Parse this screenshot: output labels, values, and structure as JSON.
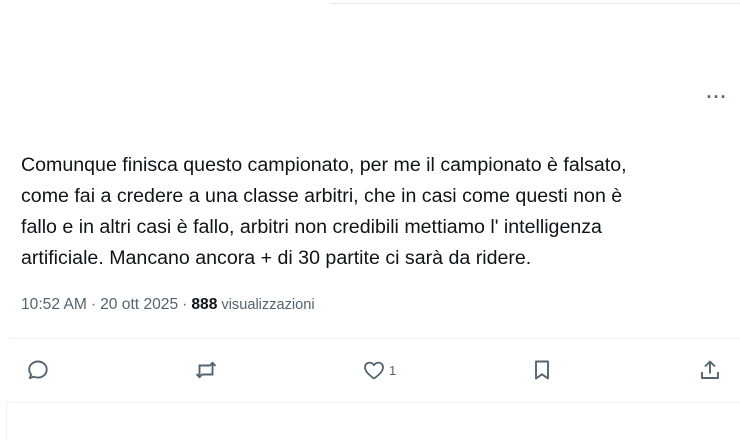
{
  "tweet": {
    "text": "Comunque finisca questo campionato, per me il campionato è falsato,\ncome fai a credere a una classe arbitri, che in casi come questi non è\nfallo e in altri casi è fallo, arbitri non credibili mettiamo l' intelligenza\nartificiale. Mancano ancora + di 30 partite ci sarà da ridere.",
    "time": "10:52 AM",
    "date": "20 ott 2025",
    "separator": "·",
    "views_count": "888",
    "views_label": "visualizzazioni"
  },
  "more_menu": {
    "label": "···",
    "icon": "more-horizontal-icon"
  },
  "actions": {
    "reply": {
      "icon": "reply-icon"
    },
    "repost": {
      "icon": "repost-icon"
    },
    "like": {
      "icon": "heart-icon",
      "count": "1"
    },
    "bookmark": {
      "icon": "bookmark-icon"
    },
    "share": {
      "icon": "share-icon"
    }
  },
  "colors": {
    "text": "#0f1419",
    "secondary": "#536471",
    "divider": "#eff3f4"
  }
}
